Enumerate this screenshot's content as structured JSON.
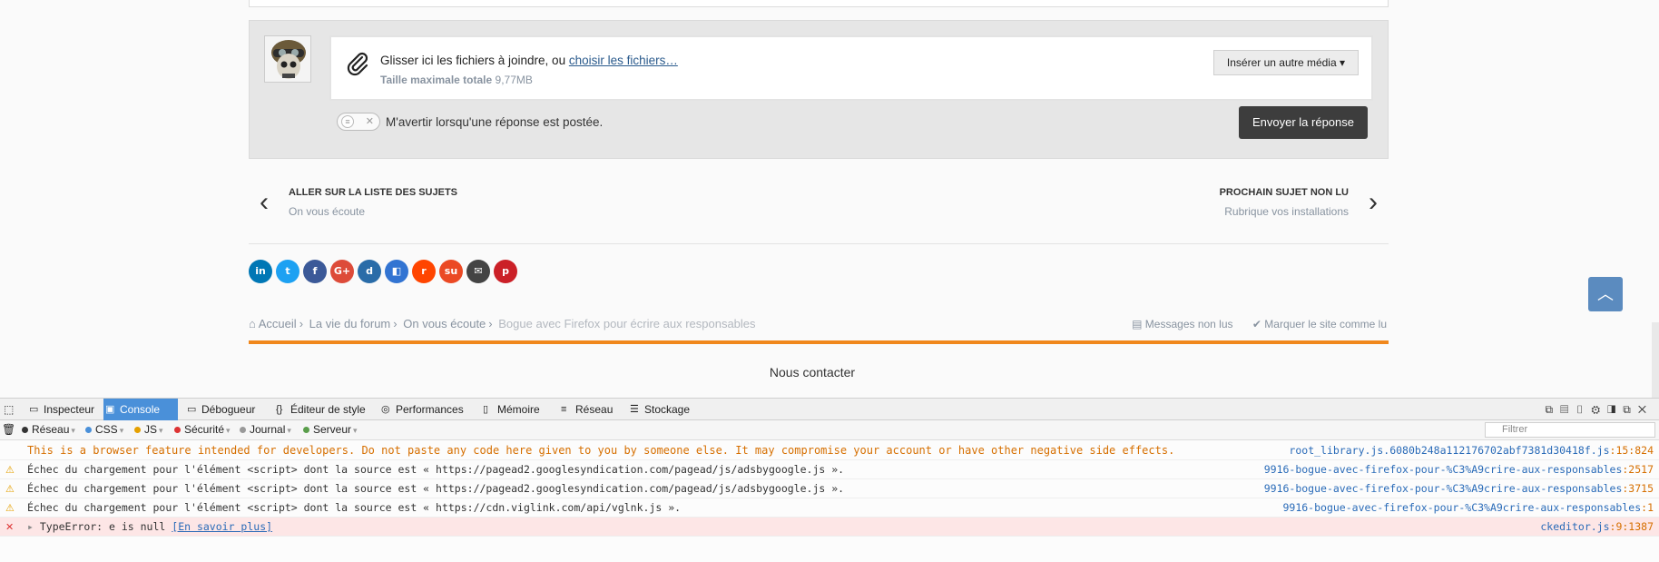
{
  "reply": {
    "upload_text": "Glisser ici les fichiers à joindre, ou ",
    "upload_link": "choisir les fichiers…",
    "max_size_label": "Taille maximale totale",
    "max_size_value": "9,77MB",
    "insert_media": "Insérer un autre média ▾",
    "notify_label": "M'avertir lorsqu'une réponse est postée.",
    "send_button": "Envoyer la réponse"
  },
  "nav": {
    "prev_title": "ALLER SUR LA LISTE DES SUJETS",
    "prev_sub": "On vous écoute",
    "next_title": "PROCHAIN SUJET NON LU",
    "next_sub": "Rubrique vos installations"
  },
  "share_icons": [
    {
      "name": "linkedin-icon",
      "glyph": "in",
      "color": "#0077b5"
    },
    {
      "name": "twitter-icon",
      "glyph": "t",
      "color": "#1da1f2"
    },
    {
      "name": "facebook-icon",
      "glyph": "f",
      "color": "#3b5998"
    },
    {
      "name": "google-plus-icon",
      "glyph": "G+",
      "color": "#dd4b39"
    },
    {
      "name": "digg-icon",
      "glyph": "d",
      "color": "#2a6ca8"
    },
    {
      "name": "delicious-icon",
      "glyph": "◧",
      "color": "#3274d2"
    },
    {
      "name": "reddit-icon",
      "glyph": "r",
      "color": "#ff4500"
    },
    {
      "name": "stumbleupon-icon",
      "glyph": "su",
      "color": "#eb4924"
    },
    {
      "name": "email-icon",
      "glyph": "✉",
      "color": "#444444"
    },
    {
      "name": "pinterest-icon",
      "glyph": "p",
      "color": "#cb2027"
    }
  ],
  "breadcrumb": {
    "home": "Accueil",
    "item1": "La vie du forum",
    "item2": "On vous écoute",
    "current": "Bogue avec Firefox pour écrire aux responsables",
    "unread": "Messages non lus",
    "mark_read": "Marquer le site comme lu"
  },
  "footer": {
    "contact": "Nous contacter"
  },
  "devtools": {
    "tabs": [
      "Inspecteur",
      "Console",
      "Débogueur",
      "Éditeur de style",
      "Performances",
      "Mémoire",
      "Réseau",
      "Stockage"
    ],
    "active_tab": "Console",
    "filters": [
      {
        "label": "Réseau",
        "color": "#333333"
      },
      {
        "label": "CSS",
        "color": "#4a90d9"
      },
      {
        "label": "JS",
        "color": "#e5a000"
      },
      {
        "label": "Sécurité",
        "color": "#d33"
      },
      {
        "label": "Journal",
        "color": "#999999"
      },
      {
        "label": "Serveur",
        "color": "#5a9e4b"
      }
    ],
    "filter_placeholder": "Filtrer",
    "messages": [
      {
        "type": "warn-big",
        "text": "This is a browser feature intended for developers. Do not paste any code here given to you by someone else. It may compromise your account or have other negative side effects.",
        "source": "root_library.js.6080b248a112176702abf7381d30418f.js",
        "line": ":15:824"
      },
      {
        "type": "warn",
        "text": "Échec du chargement pour l'élément <script> dont la source est « https://pagead2.googlesyndication.com/pagead/js/adsbygoogle.js ».",
        "source": "9916-bogue-avec-firefox-pour-%C3%A9crire-aux-responsables",
        "line": ":2517"
      },
      {
        "type": "warn",
        "text": "Échec du chargement pour l'élément <script> dont la source est « https://pagead2.googlesyndication.com/pagead/js/adsbygoogle.js ».",
        "source": "9916-bogue-avec-firefox-pour-%C3%A9crire-aux-responsables",
        "line": ":3715"
      },
      {
        "type": "warn",
        "text": "Échec du chargement pour l'élément <script> dont la source est « https://cdn.viglink.com/api/vglnk.js ».",
        "source": "9916-bogue-avec-firefox-pour-%C3%A9crire-aux-responsables",
        "line": ":1"
      },
      {
        "type": "error",
        "text": "TypeError: e is null ",
        "link": "[En savoir plus]",
        "source": "ckeditor.js",
        "line": ":9:1387"
      }
    ]
  }
}
